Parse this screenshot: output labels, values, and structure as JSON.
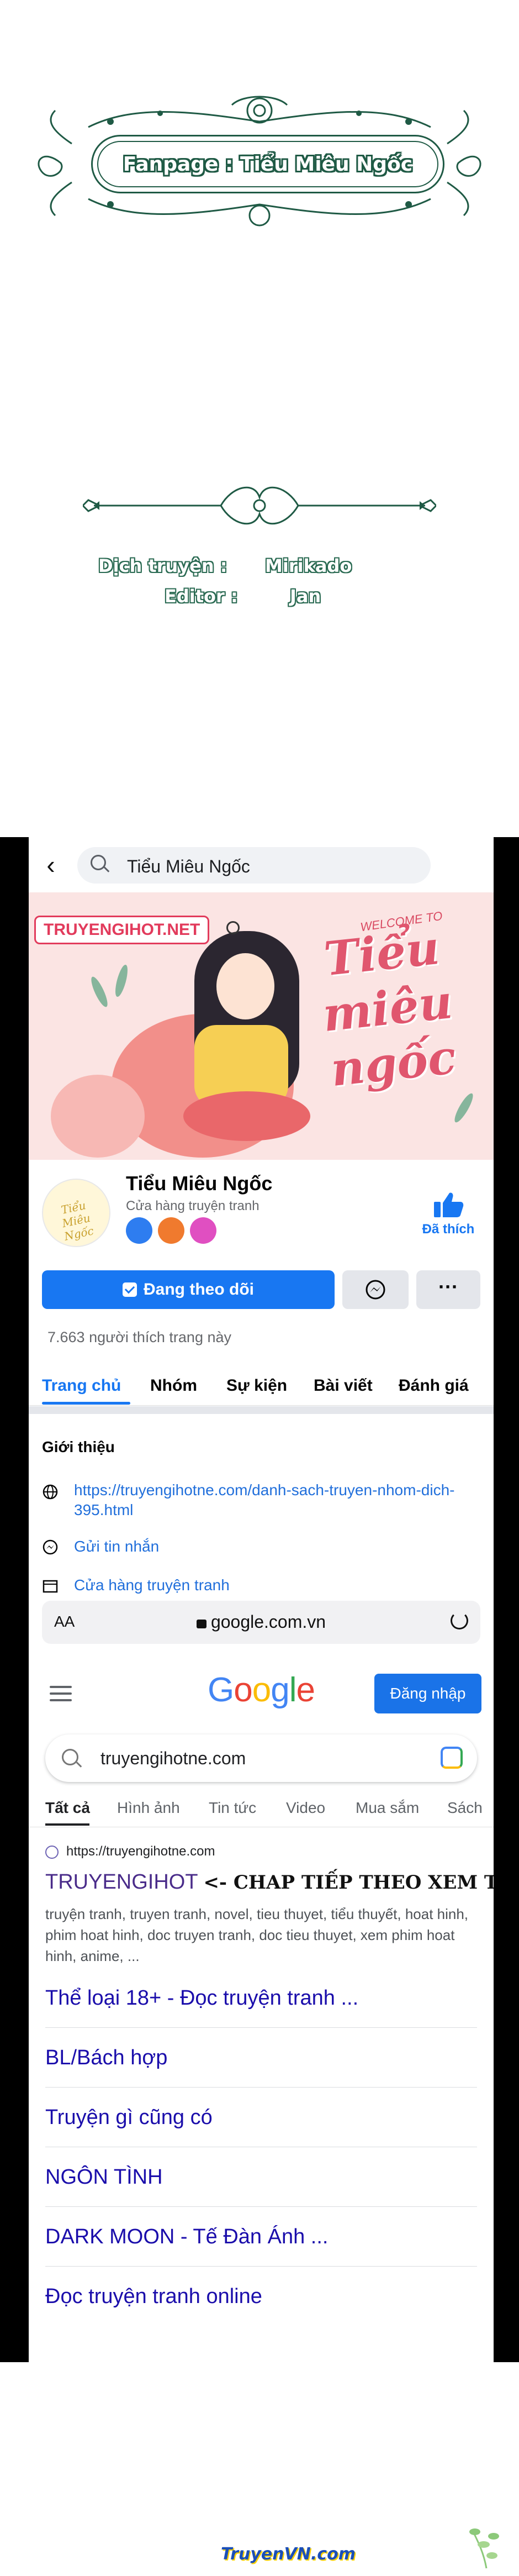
{
  "credits": {
    "fanpage": "Fanpage : Tiểu Miêu Ngốc",
    "translator_label": "Dịch truyện :",
    "translator_name": "Mirikado",
    "editor_label": "Editor :",
    "editor_name": "Jan"
  },
  "facebook": {
    "search_query": "Tiểu Miêu Ngốc",
    "cover": {
      "watermark": "TRUYENGIHOT.NET",
      "welcome": "WELCOME TO",
      "title_art": "Tiểu miêu ngốc"
    },
    "page_name": "Tiểu Miêu Ngốc",
    "page_category": "Cửa hàng truyện tranh",
    "liked_label": "Đã thích",
    "follow_label": "Đang theo dõi",
    "more_label": "···",
    "likes_count": "7.663 người thích trang này",
    "tabs": [
      "Trang chủ",
      "Nhóm",
      "Sự kiện",
      "Bài viết",
      "Đánh giá"
    ],
    "intro_title": "Giới thiệu",
    "intro_link": "https://truyengihotne.com/danh-sach-truyen-nhom-dich-395.html",
    "intro_message": "Gửi tin nhắn",
    "intro_category": "Cửa hàng truyện tranh",
    "colors": {
      "accent": "#1877f2"
    }
  },
  "browser": {
    "aa": "AA",
    "url": "google.com.vn"
  },
  "google": {
    "logo": "Google",
    "signin": "Đăng nhập",
    "query": "truyengihotne.com",
    "tabs": [
      "Tất cả",
      "Hình ảnh",
      "Tin tức",
      "Video",
      "Mua sắm",
      "Sách"
    ],
    "result": {
      "site": "https://truyengihotne.com",
      "title": "TRUYENGIHOT",
      "handwritten_note": "<- CHAP TIẾP THEO XEM TẠI ĐÂY NHA",
      "snippet": "truyện tranh, truyen tranh, novel, tieu thuyet, tiểu thuyết, hoat hinh, phim hoat hinh, doc truyen tranh, doc tieu thuyet, xem phim hoat hinh, anime, ..."
    },
    "sitelinks": [
      "Thể loại 18+ - Đọc truyện tranh ...",
      "BL/Bách hợp",
      "Truyện gì cũng có",
      "NGÔN TÌNH",
      "DARK MOON - Tế Đàn Ánh ...",
      "Đọc truyện tranh online"
    ]
  },
  "footer": {
    "logo": "TruyenVN.com"
  }
}
